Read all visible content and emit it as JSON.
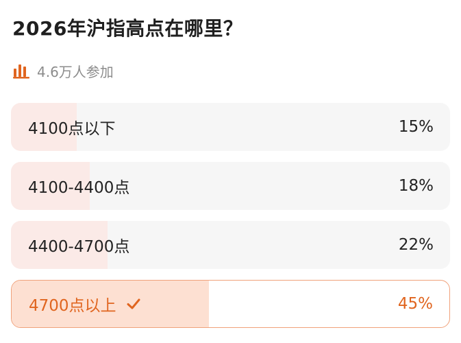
{
  "poll": {
    "title": "2026年沪指高点在哪里？",
    "participants": "4.6万人参加",
    "icon": "bar-chart-icon",
    "accent_color": "#e0651f",
    "options": [
      {
        "label": "4100点以下",
        "percent_text": "15%",
        "share": 0.15,
        "selected": false
      },
      {
        "label": "4100-4400点",
        "percent_text": "18%",
        "share": 0.18,
        "selected": false
      },
      {
        "label": "4400-4700点",
        "percent_text": "22%",
        "share": 0.22,
        "selected": false
      },
      {
        "label": "4700点以上",
        "percent_text": "45%",
        "share": 0.45,
        "selected": true,
        "selected_icon": "check-icon"
      }
    ]
  }
}
